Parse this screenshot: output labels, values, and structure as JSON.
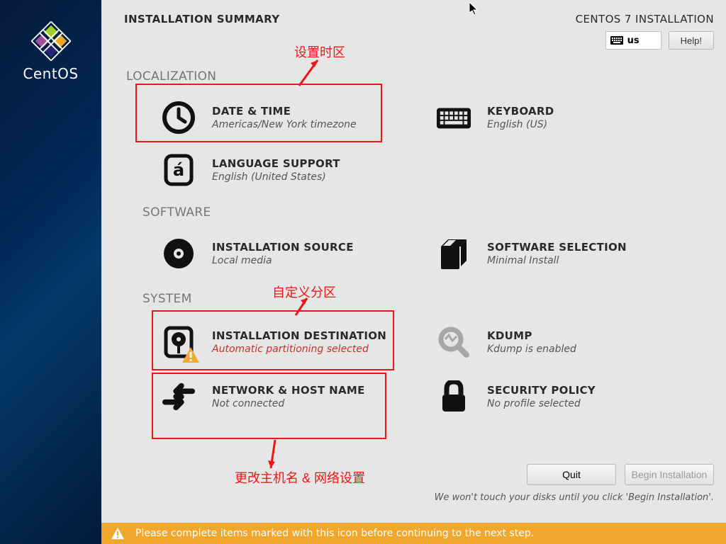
{
  "brand": "CentOS",
  "header": {
    "title": "INSTALLATION SUMMARY",
    "subtitle": "CENTOS 7 INSTALLATION",
    "keyboard_layout": "us",
    "help_label": "Help!"
  },
  "sections": {
    "localization": "LOCALIZATION",
    "software": "SOFTWARE",
    "system": "SYSTEM"
  },
  "spokes": {
    "datetime": {
      "title": "DATE & TIME",
      "status": "Americas/New York timezone"
    },
    "keyboard": {
      "title": "KEYBOARD",
      "status": "English (US)"
    },
    "language": {
      "title": "LANGUAGE SUPPORT",
      "status": "English (United States)"
    },
    "source": {
      "title": "INSTALLATION SOURCE",
      "status": "Local media"
    },
    "swsel": {
      "title": "SOFTWARE SELECTION",
      "status": "Minimal Install"
    },
    "dest": {
      "title": "INSTALLATION DESTINATION",
      "status": "Automatic partitioning selected"
    },
    "kdump": {
      "title": "KDUMP",
      "status": "Kdump is enabled"
    },
    "network": {
      "title": "NETWORK & HOST NAME",
      "status": "Not connected"
    },
    "security": {
      "title": "SECURITY POLICY",
      "status": "No profile selected"
    }
  },
  "annotations": {
    "timezone": "设置时区",
    "partition": "自定义分区",
    "network": "更改主机名 & 网络设置"
  },
  "footer": {
    "quit": "Quit",
    "begin": "Begin Installation",
    "hint": "We won't touch your disks until you click 'Begin Installation'.",
    "warning": "Please complete items marked with this icon before continuing to the next step."
  }
}
